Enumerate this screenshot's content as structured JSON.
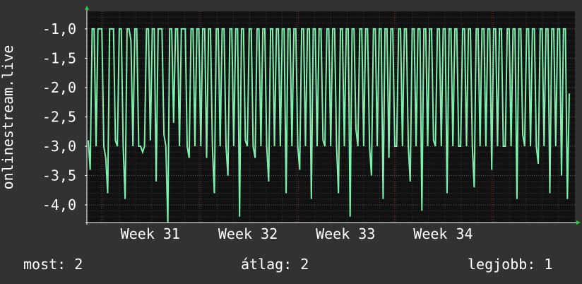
{
  "chart_data": {
    "type": "line",
    "ylabel": "onlinestream.live",
    "xlabel": "",
    "title": "",
    "ylim": [
      -4.3,
      -0.7
    ],
    "yticks": [
      -1.0,
      -1.5,
      -2.0,
      -2.5,
      -3.0,
      -3.5,
      -4.0
    ],
    "ytick_labels": [
      "-1,0",
      "-1,5",
      "-2,0",
      "-2,5",
      "-3,0",
      "-3,5",
      "-4,0"
    ],
    "x_range": [
      0,
      100
    ],
    "xticks": [
      {
        "x": 13,
        "label": "Week 31"
      },
      {
        "x": 33,
        "label": "Week 32"
      },
      {
        "x": 53,
        "label": "Week 33"
      },
      {
        "x": 73,
        "label": "Week 34"
      }
    ],
    "week_boundaries": [
      3,
      23,
      43,
      63,
      83
    ],
    "grid": true,
    "series": [
      {
        "values": [
          -2.9,
          -3.4,
          -1.0,
          -1.0,
          -3.0,
          -1.0,
          -1.0,
          -1.0,
          -3.0,
          -3.2,
          -3.8,
          -1.0,
          -1.0,
          -1.0,
          -2.9,
          -3.0,
          -1.0,
          -1.0,
          -3.0,
          -3.9,
          -1.0,
          -1.0,
          -1.2,
          -3.0,
          -1.0,
          -1.0,
          -3.0,
          -3.0,
          -3.1,
          -3.0,
          -1.0,
          -1.0,
          -2.9,
          -1.0,
          -1.0,
          -3.6,
          -1.0,
          -1.0,
          -1.0,
          -2.8,
          -3.0,
          -4.3,
          -1.0,
          -1.0,
          -2.6,
          -1.0,
          -1.0,
          -3.0,
          -1.0,
          -1.0,
          -1.0,
          -3.0,
          -3.2,
          -1.0,
          -1.0,
          -3.0,
          -1.0,
          -1.0,
          -3.0,
          -1.0,
          -1.0,
          -3.2,
          -1.0,
          -1.0,
          -3.0,
          -3.8,
          -1.0,
          -1.0,
          -3.0,
          -1.0,
          -1.0,
          -3.0,
          -3.5,
          -1.0,
          -1.0,
          -3.0,
          -1.0,
          -1.0,
          -4.2,
          -1.0,
          -1.0,
          -2.9,
          -3.0,
          -1.0,
          -1.0,
          -3.0,
          -3.2,
          -1.0,
          -1.0,
          -3.0,
          -1.0,
          -1.0,
          -3.0,
          -3.6,
          -1.0,
          -1.0,
          -3.0,
          -1.0,
          -1.0,
          -3.0,
          -1.0,
          -1.0,
          -3.8,
          -1.0,
          -1.0,
          -3.0,
          -1.0,
          -1.0,
          -3.0,
          -3.4,
          -1.0,
          -1.0,
          -3.0,
          -1.0,
          -1.0,
          -3.9,
          -1.0,
          -1.0,
          -3.0,
          -1.0,
          -1.0,
          -2.9,
          -3.0,
          -1.0,
          -1.0,
          -3.0,
          -1.0,
          -1.0,
          -3.0,
          -3.8,
          -1.0,
          -1.0,
          -3.0,
          -1.0,
          -1.0,
          -4.2,
          -1.0,
          -1.0,
          -2.7,
          -3.0,
          -1.0,
          -1.0,
          -3.0,
          -1.0,
          -1.0,
          -3.0,
          -3.5,
          -1.0,
          -1.0,
          -3.0,
          -1.0,
          -1.0,
          -3.9,
          -1.0,
          -1.0,
          -3.2,
          -1.0,
          -1.0,
          -3.0,
          -3.0,
          -1.0,
          -1.0,
          -3.0,
          -1.0,
          -1.0,
          -3.0,
          -3.6,
          -1.0,
          -1.0,
          -3.0,
          -1.0,
          -1.0,
          -4.1,
          -1.0,
          -1.0,
          -3.0,
          -1.0,
          -1.0,
          -2.9,
          -3.0,
          -1.0,
          -1.0,
          -3.0,
          -1.0,
          -1.0,
          -3.8,
          -1.0,
          -1.0,
          -3.0,
          -1.0,
          -1.0,
          -3.0,
          -3.0,
          -1.0,
          -1.0,
          -3.0,
          -1.0,
          -1.0,
          -3.0,
          -3.7,
          -1.0,
          -1.0,
          -3.0,
          -1.0,
          -1.0,
          -3.0,
          -1.0,
          -1.0,
          -3.4,
          -1.0,
          -1.0,
          -3.0,
          -1.0,
          -1.0,
          -3.0,
          -3.0,
          -1.0,
          -1.0,
          -3.0,
          -1.0,
          -1.0,
          -3.9,
          -1.0,
          -1.0,
          -2.8,
          -3.0,
          -1.0,
          -1.0,
          -3.0,
          -1.0,
          -1.0,
          -3.0,
          -3.3,
          -1.0,
          -1.0,
          -3.0,
          -1.0,
          -1.0,
          -3.8,
          -1.0,
          -1.0,
          -3.0,
          -1.0,
          -1.0,
          -3.5,
          -1.0,
          -1.0,
          -3.9,
          -2.1
        ]
      }
    ],
    "line_color": "#7ff0b0",
    "plot_background": "#111111",
    "grid_color": "#3a3a3a",
    "week_line_color": "#7a3434"
  },
  "footer": {
    "now": "most: 2",
    "avg": "átlag: 2",
    "best": "legjobb: 1"
  }
}
